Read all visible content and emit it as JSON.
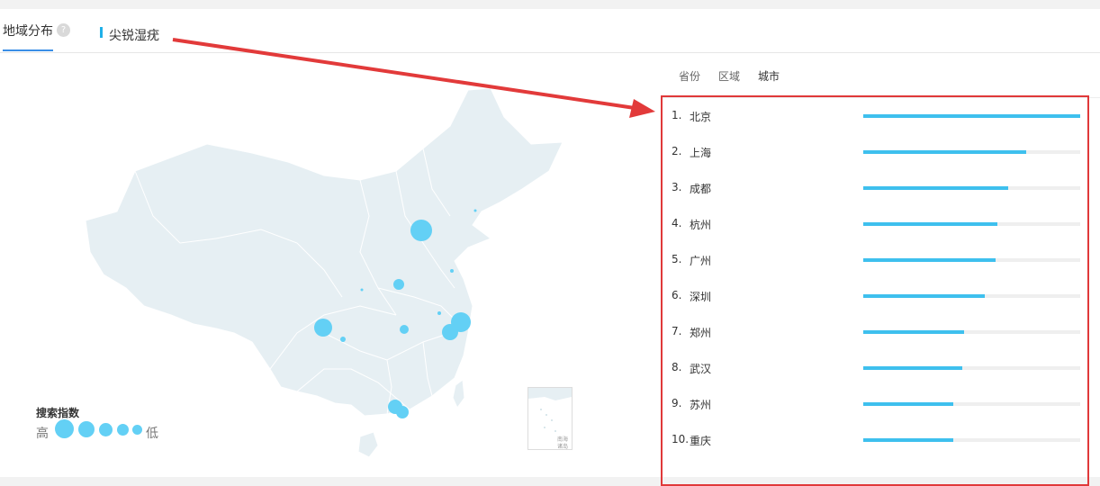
{
  "tabs": {
    "main_label": "地域分布",
    "help_icon": "question-circle-icon",
    "sub_label": "尖锐湿疣"
  },
  "toggle": {
    "options": [
      "省份",
      "区域",
      "城市"
    ],
    "selected": "城市"
  },
  "legend": {
    "title": "搜索指数",
    "high": "高",
    "low": "低"
  },
  "inset": {
    "label_line1": "南海",
    "label_line2": "诸岛"
  },
  "ranking": [
    {
      "rank": "1.",
      "city": "北京",
      "value": 1.0
    },
    {
      "rank": "2.",
      "city": "上海",
      "value": 0.75
    },
    {
      "rank": "3.",
      "city": "成都",
      "value": 0.67
    },
    {
      "rank": "4.",
      "city": "杭州",
      "value": 0.62
    },
    {
      "rank": "5.",
      "city": "广州",
      "value": 0.61
    },
    {
      "rank": "6.",
      "city": "深圳",
      "value": 0.56
    },
    {
      "rank": "7.",
      "city": "郑州",
      "value": 0.465
    },
    {
      "rank": "8.",
      "city": "武汉",
      "value": 0.455
    },
    {
      "rank": "9.",
      "city": "苏州",
      "value": 0.415
    },
    {
      "rank": "10.",
      "city": "重庆",
      "value": 0.415
    }
  ],
  "colors": {
    "accent": "#3ec0ee",
    "bubble": "#63d0f5",
    "map_fill": "#e6eff3",
    "highlight_border": "#e0393a",
    "tab_underline": "#3a8ee6"
  }
}
